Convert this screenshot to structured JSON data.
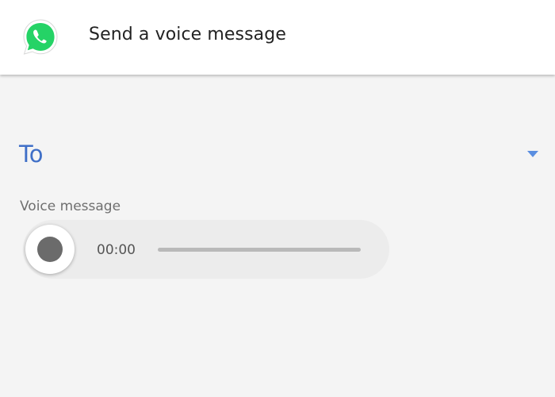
{
  "header": {
    "app_icon": "whatsapp-logo-icon",
    "title": "Send a voice message"
  },
  "form": {
    "to_label": "To",
    "dropdown_icon": "triangle-down-icon",
    "voice_label": "Voice message"
  },
  "player": {
    "record_icon": "record-dot-icon",
    "time": "00:00",
    "progress": 0
  },
  "colors": {
    "accent": "#3f6fc7",
    "dropdown": "#5a8ee0",
    "whatsapp_green": "#25d366",
    "background": "#f4f4f4"
  }
}
